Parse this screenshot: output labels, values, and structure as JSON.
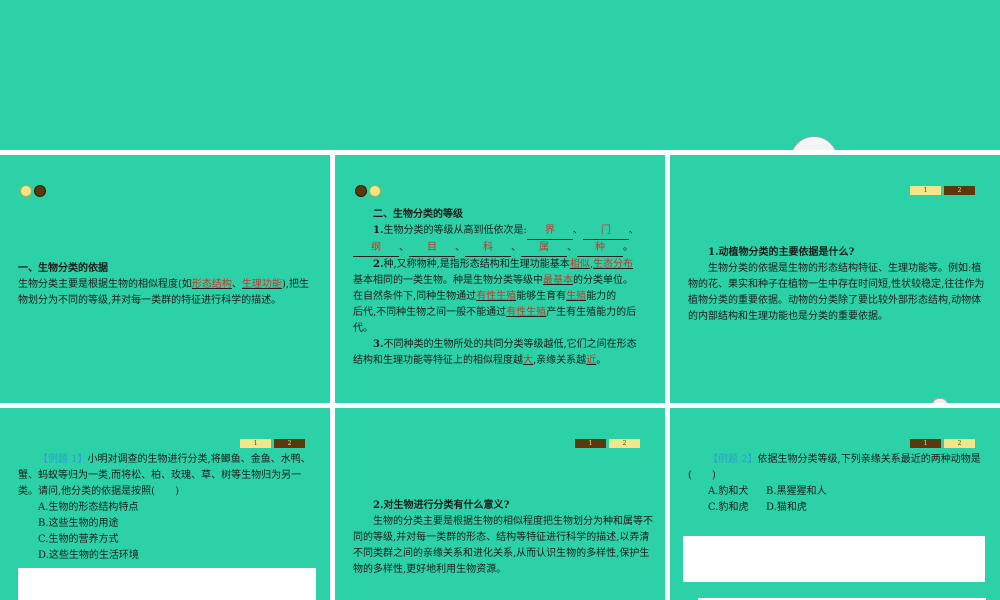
{
  "slide1": {
    "heading": "一、生物分类的依据",
    "p_a": "生物分类主要是根据生物的相似程度(如",
    "ans1": "形态结构",
    "p_b": "、",
    "ans2": "生理功能",
    "p_c": "),把生",
    "p_d": "物划分为不同的等级,并对每一类群的特征进行科学的描述。"
  },
  "slide2": {
    "heading": "二、生物分类的等级",
    "q1_prefix": "1.",
    "q1_text": "生物分类的等级从高到低依次是:",
    "ranks": [
      "界",
      "门",
      "纲",
      "目",
      "科",
      "属",
      "种"
    ],
    "sep": "、",
    "end": "。",
    "q2_prefix": "2.",
    "q2_a": "种,又称物种,是指形态结构和生理功能基本",
    "q2_ans1": "相似",
    "q2_b": ",",
    "q2_ans2": "生态分布",
    "q2_c": "基本相同的一类生物。种是生物分类等级中",
    "q2_ans3": "最基本",
    "q2_d": "的分类单位。",
    "q2_e": "在自然条件下,同种生物通过",
    "q2_ans4": "有性生殖",
    "q2_f": "能够生育有",
    "q2_ans5": "生殖",
    "q2_g": "能力的",
    "q2_h": "后代,不同种生物之间一般不能通过",
    "q2_ans6": "有性生殖",
    "q2_i": "产生有生殖能力的后",
    "q2_j": "代。",
    "q3_prefix": "3.",
    "q3_a": "不同种类的生物所处的共同分类等级越低,它们之间在形态",
    "q3_b": "结构和生理功能等特征上的相似程度越",
    "q3_ans1": "大",
    "q3_c": ",亲缘关系越",
    "q3_ans2": "近",
    "q3_d": "。"
  },
  "slide3": {
    "tab1": "1",
    "tab2": "2",
    "question": "1.动植物分类的主要依据是什么?",
    "answer": "生物分类的依据是生物的形态结构特征、生理功能等。例如:植物的花、果实和种子在植物一生中存在时间短,性状较稳定,往往作为植物分类的重要依据。动物的分类除了要比较外部形态结构,动物体的内部结构和生理功能也是分类的重要依据。"
  },
  "slide4": {
    "tab1": "1",
    "tab2": "2",
    "label": "【例题 1】",
    "stem": "小明对调查的生物进行分类,将鲫鱼、金鱼、水鸭、蟹、蚂蚁等归为一类,而将松、柏、玫瑰、草、树等生物归为另一类。请问,他分类的依据是按照(　　)",
    "options": [
      "A.生物的形态结构特点",
      "B.这些生物的用途",
      "C.生物的营养方式",
      "D.这些生物的生活环境"
    ]
  },
  "slide5": {
    "tab1": "1",
    "tab2": "2",
    "question": "2.对生物进行分类有什么意义?",
    "answer": "生物的分类主要是根据生物的相似程度把生物划分为种和属等不同的等级,并对每一类群的形态、结构等特征进行科学的描述,以弄清不同类群之间的亲缘关系和进化关系,从而认识生物的多样性,保护生物的多样性,更好地利用生物资源。"
  },
  "slide6": {
    "tab1": "1",
    "tab2": "2",
    "label": "【例题 2】",
    "stem": "依据生物分类等级,下列亲缘关系最近的两种动物是(　　)",
    "opt_a": "A.豹和犬",
    "opt_b": "B.黑猩猩和人",
    "opt_c": "C.豹和虎",
    "opt_d": "D.猫和虎"
  },
  "colors": {
    "slide_bg": "#2dd1a7",
    "answer_red": "#c0392b",
    "tab_yellow": "#f3e58a",
    "tab_brown": "#5a3a0c",
    "example_blue": "#29a0d6"
  }
}
